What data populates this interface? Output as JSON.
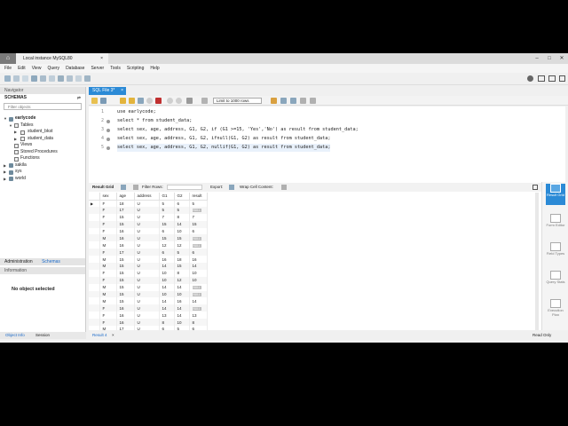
{
  "window": {
    "home_icon": "home-icon",
    "connection_tab": "Local instance MySQL80",
    "close_glyph": "×"
  },
  "menu": [
    "File",
    "Edit",
    "View",
    "Query",
    "Database",
    "Server",
    "Tools",
    "Scripting",
    "Help"
  ],
  "navigator": {
    "header": "Navigator",
    "schemas_label": "SCHEMAS",
    "filter_placeholder": "Filter objects",
    "tree": [
      {
        "label": "earlycode",
        "kind": "db",
        "bold": true
      },
      {
        "label": "Tables",
        "kind": "folder"
      },
      {
        "label": "student_bkst",
        "kind": "table"
      },
      {
        "label": "student_data",
        "kind": "table"
      },
      {
        "label": "Views",
        "kind": "leaf"
      },
      {
        "label": "Stored Procedures",
        "kind": "leaf"
      },
      {
        "label": "Functions",
        "kind": "leaf"
      },
      {
        "label": "sakila",
        "kind": "db"
      },
      {
        "label": "sys",
        "kind": "db"
      },
      {
        "label": "world",
        "kind": "db"
      }
    ],
    "tab_admin": "Administration",
    "tab_schemas": "Schemas",
    "info_header": "Information",
    "no_object": "No object selected",
    "bottom_tab_info": "Object Info",
    "bottom_tab_session": "Session"
  },
  "editor": {
    "tab_label": "SQL File 3*",
    "limit_label": "Limit to 1000 rows",
    "lines": [
      {
        "n": "1",
        "text": "use earlycode;"
      },
      {
        "n": "2",
        "text": "select * from student_data;"
      },
      {
        "n": "3",
        "text": "select sex, age, address, G1, G2, if (G1 >=15, 'Yes','No') as result from student_data;"
      },
      {
        "n": "4",
        "text": "select sex, age, address, G1, G2, ifnull(G1, G2) as result from student_data;"
      },
      {
        "n": "5",
        "text": "select sex, age, address, G1, G2, nullif(G1, G2) as result from student_data;"
      }
    ]
  },
  "results": {
    "grid_label": "Result Grid",
    "filter_label": "Filter Rows:",
    "export_label": "Export:",
    "wrap_label": "Wrap Cell Content:",
    "columns": [
      "sex",
      "age",
      "address",
      "G1",
      "G2",
      "result"
    ],
    "rows": [
      [
        "F",
        "18",
        "U",
        "5",
        "6",
        "5"
      ],
      [
        "F",
        "17",
        "U",
        "5",
        "5",
        "NULL"
      ],
      [
        "F",
        "15",
        "U",
        "7",
        "8",
        "7"
      ],
      [
        "F",
        "15",
        "U",
        "15",
        "14",
        "15"
      ],
      [
        "F",
        "16",
        "U",
        "6",
        "10",
        "6"
      ],
      [
        "M",
        "16",
        "U",
        "15",
        "15",
        "NULL"
      ],
      [
        "M",
        "16",
        "U",
        "12",
        "12",
        "NULL"
      ],
      [
        "F",
        "17",
        "U",
        "6",
        "5",
        "6"
      ],
      [
        "M",
        "15",
        "U",
        "16",
        "18",
        "16"
      ],
      [
        "M",
        "15",
        "U",
        "14",
        "15",
        "14"
      ],
      [
        "F",
        "15",
        "U",
        "10",
        "8",
        "10"
      ],
      [
        "F",
        "15",
        "U",
        "10",
        "12",
        "10"
      ],
      [
        "M",
        "15",
        "U",
        "14",
        "14",
        "NULL"
      ],
      [
        "M",
        "15",
        "U",
        "10",
        "10",
        "NULL"
      ],
      [
        "M",
        "15",
        "U",
        "14",
        "16",
        "14"
      ],
      [
        "F",
        "16",
        "U",
        "14",
        "14",
        "NULL"
      ],
      [
        "F",
        "16",
        "U",
        "13",
        "14",
        "13"
      ],
      [
        "F",
        "16",
        "U",
        "8",
        "10",
        "8"
      ],
      [
        "M",
        "17",
        "U",
        "6",
        "5",
        "6"
      ]
    ],
    "result_tab": "Result 4",
    "read_only": "Read Only"
  },
  "side_panel": [
    {
      "label": "Result Grid",
      "active": true
    },
    {
      "label": "Form Editor",
      "active": false
    },
    {
      "label": "Field Types",
      "active": false
    },
    {
      "label": "Query Stats",
      "active": false
    },
    {
      "label": "Execution Plan",
      "active": false
    }
  ],
  "colors": {
    "accent": "#2b8ad6",
    "null_badge": "#bdbdbd"
  }
}
